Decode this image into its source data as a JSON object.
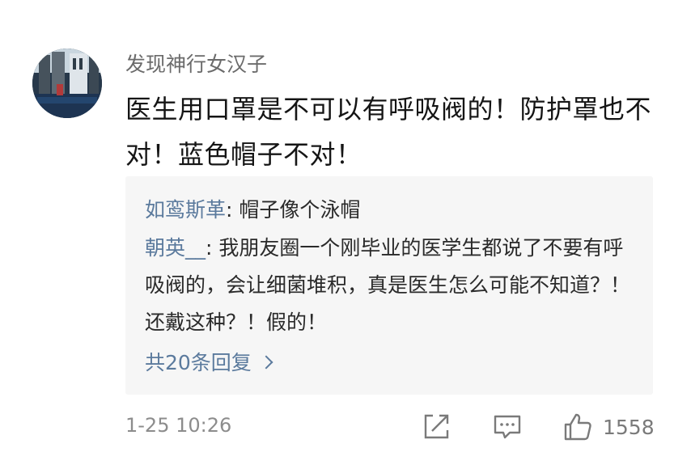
{
  "comment": {
    "username": "发现神行女汉子",
    "text": "医生用口罩是不可以有呼吸阀的！防护罩也不对！蓝色帽子不对！",
    "timestamp": "1-25 10:26",
    "like_count": "1558"
  },
  "replies": [
    {
      "author": "如鸾斯革",
      "text": "帽子像个泳帽"
    },
    {
      "author": "朝英__",
      "text": "我朋友圈一个刚毕业的医学生都说了不要有呼吸阀的，会让细菌堆积，真是医生怎么可能不知道？！还戴这种？！假的！"
    }
  ],
  "more_replies_label": "共20条回复",
  "icons": {
    "share": "share-icon",
    "reply": "comment-icon",
    "like": "thumbs-up-icon",
    "more": "chevron-right-icon"
  },
  "colors": {
    "link": "#5b7a9d",
    "username": "#6b6b6b",
    "reply_background": "#f6f6f6",
    "muted": "#8c8c8c"
  }
}
